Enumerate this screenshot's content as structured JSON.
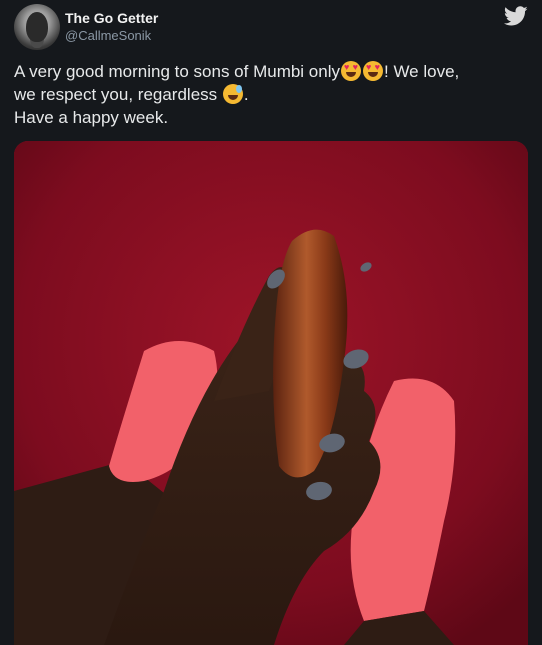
{
  "tweet": {
    "display_name": "The Go Getter",
    "handle": "@CallmeSonik",
    "text_line1_a": "A very good morning to sons of Mumbi only",
    "text_line1_b": "! We love,",
    "text_line2": "we respect you, regardless ",
    "text_line2_end": ".",
    "text_line3": "Have a happy week."
  },
  "icons": {
    "brand": "twitter-bird-icon",
    "emoji_1": "heart-eyes-emoji",
    "emoji_2": "heart-eyes-emoji",
    "emoji_3": "grinning-sweat-emoji"
  },
  "colors": {
    "background": "#15181c",
    "twitter_blue": "#1d9bf0",
    "rug_red": "#8c0f22",
    "sock_pink": "#f2616a",
    "nail_gray": "#5f6673"
  }
}
